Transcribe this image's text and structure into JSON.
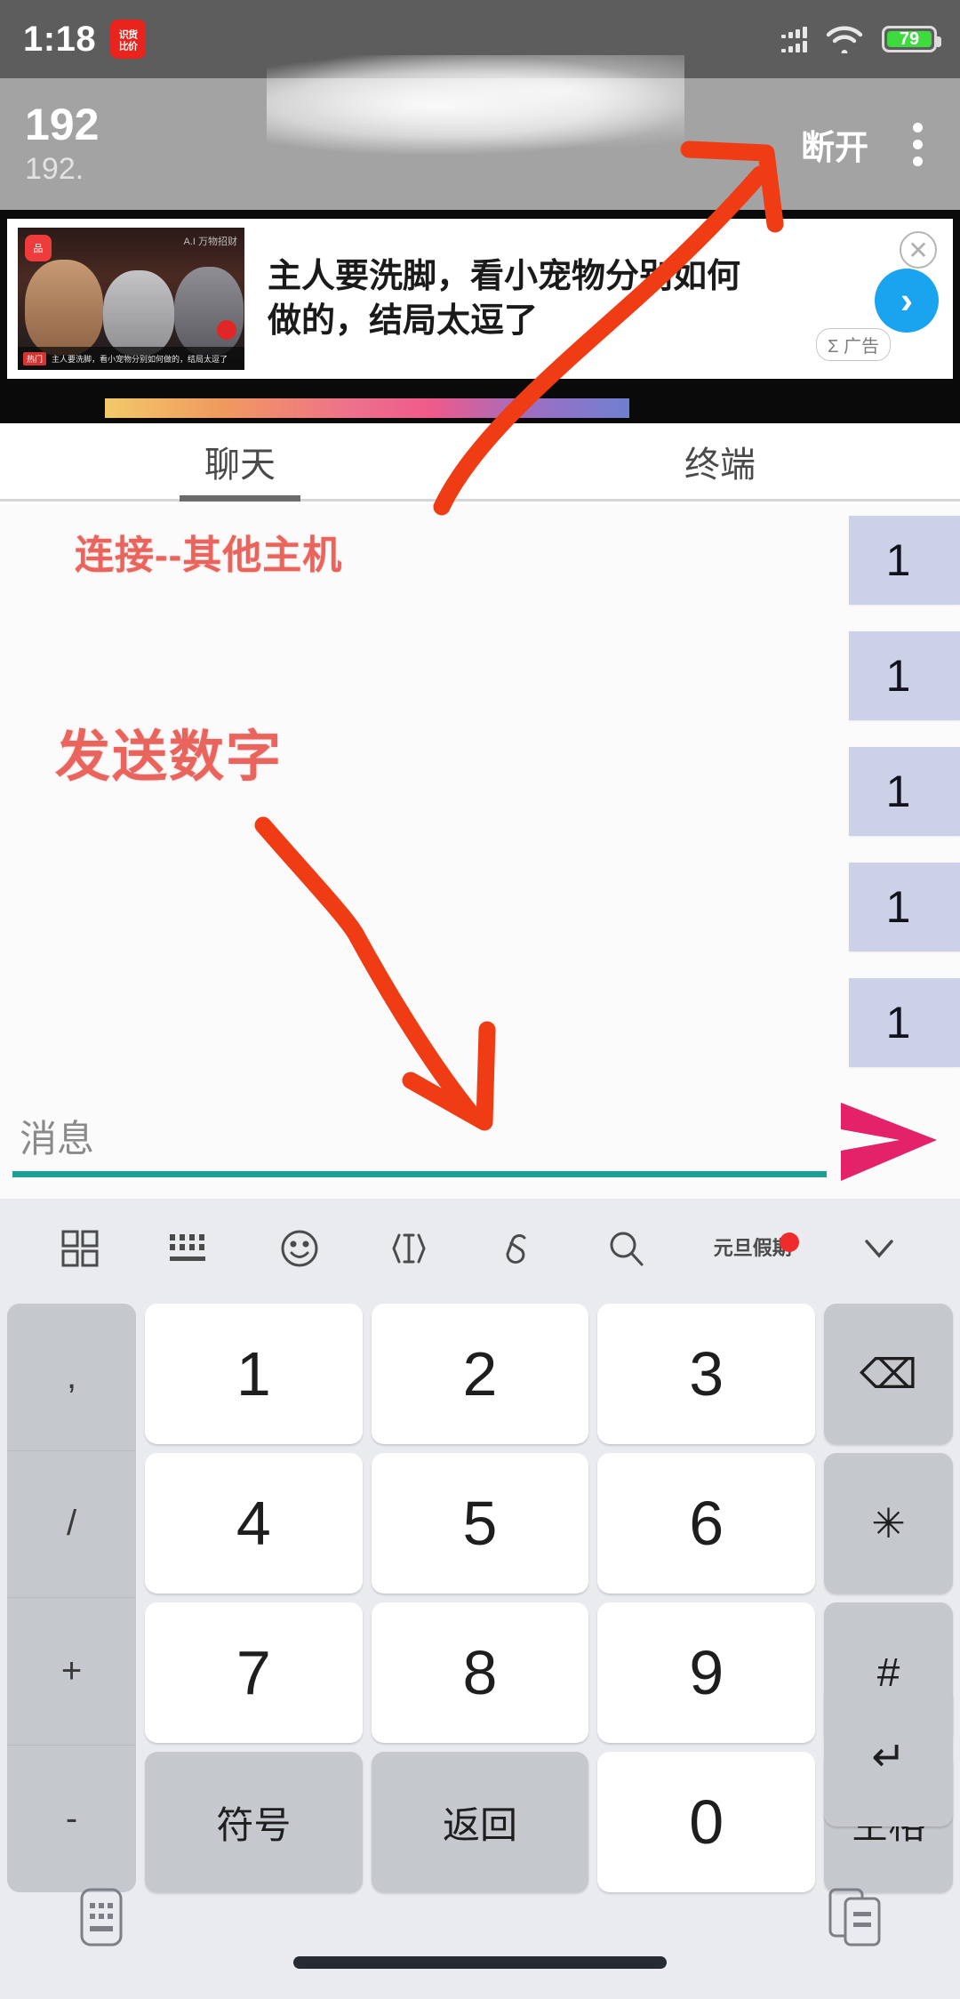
{
  "status_bar": {
    "time": "1:18",
    "app_badge_line1": "识货",
    "app_badge_line2": "比价",
    "battery_percent": "79",
    "signal_icon": "signal-bars-icon",
    "wifi_icon": "wifi-icon",
    "battery_icon": "battery-icon"
  },
  "app_bar": {
    "title": "192",
    "subtitle": "192.",
    "disconnect_label": "断开",
    "more_icon": "overflow-menu-icon"
  },
  "ad": {
    "headline_line1": "主人要洗脚，看小宠物分别如何",
    "headline_line2": "做的，结局太逗了",
    "badge_label": "Σ 广告",
    "close_icon": "close-icon",
    "go_icon": "chevron-right-icon",
    "thumb_badge": "品",
    "thumb_corner": "A.I 万物招财",
    "thumb_caption_tag": "热门",
    "thumb_caption_text": "主人要洗脚，看小宠物分别如何做的，结局太逗了"
  },
  "tabs": [
    {
      "label": "聊天",
      "active": true
    },
    {
      "label": "终端",
      "active": false
    }
  ],
  "annotations": {
    "note_connect": "连接--其他主机",
    "note_send": "发送数字",
    "color": "#e8645c",
    "arrow_color": "#f03c14"
  },
  "chat": {
    "messages": [
      {
        "text": "1"
      },
      {
        "text": "1"
      },
      {
        "text": "1"
      },
      {
        "text": "1"
      },
      {
        "text": "1"
      }
    ],
    "bubble_color": "#ccd1e8"
  },
  "composer": {
    "placeholder": "消息",
    "value": "",
    "underline_color": "#1aa094",
    "send_icon": "send-arrow-icon",
    "send_color": "#e3226a"
  },
  "keyboard": {
    "toolbar": [
      {
        "icon": "grid-apps-icon",
        "label": ""
      },
      {
        "icon": "keyboard-icon",
        "label": ""
      },
      {
        "icon": "emoji-icon",
        "label": ""
      },
      {
        "icon": "text-cursor-icon",
        "label": ""
      },
      {
        "icon": "paperclip-icon",
        "label": ""
      },
      {
        "icon": "search-icon",
        "label": ""
      },
      {
        "icon": "festival-icon",
        "label": "元旦假期",
        "badge": true
      },
      {
        "icon": "chevron-down-icon",
        "label": ""
      }
    ],
    "side_keys": [
      ",",
      "/",
      "+",
      "-"
    ],
    "rows": [
      [
        {
          "label": "1",
          "type": "num"
        },
        {
          "label": "2",
          "type": "num"
        },
        {
          "label": "3",
          "type": "num"
        },
        {
          "label": "⌫",
          "type": "fn",
          "name": "backspace-key"
        }
      ],
      [
        {
          "label": "4",
          "type": "num"
        },
        {
          "label": "5",
          "type": "num"
        },
        {
          "label": "6",
          "type": "num"
        },
        {
          "label": "✳",
          "type": "fn",
          "name": "asterisk-key"
        }
      ],
      [
        {
          "label": "7",
          "type": "num"
        },
        {
          "label": "8",
          "type": "num"
        },
        {
          "label": "9",
          "type": "num"
        },
        {
          "label": "#",
          "type": "fn",
          "name": "hash-key"
        }
      ],
      [
        {
          "label": "符号",
          "type": "fn-txt",
          "name": "symbols-key"
        },
        {
          "label": "返回",
          "type": "fn-txt",
          "name": "return-key"
        },
        {
          "label": "0",
          "type": "num"
        },
        {
          "label": "空格",
          "type": "fn-txt",
          "name": "space-key"
        },
        {
          "label": "↵",
          "type": "fn",
          "name": "enter-key"
        }
      ]
    ],
    "bottom_left_icon": "keyboard-switch-icon",
    "bottom_right_icon": "clipboard-icon"
  }
}
